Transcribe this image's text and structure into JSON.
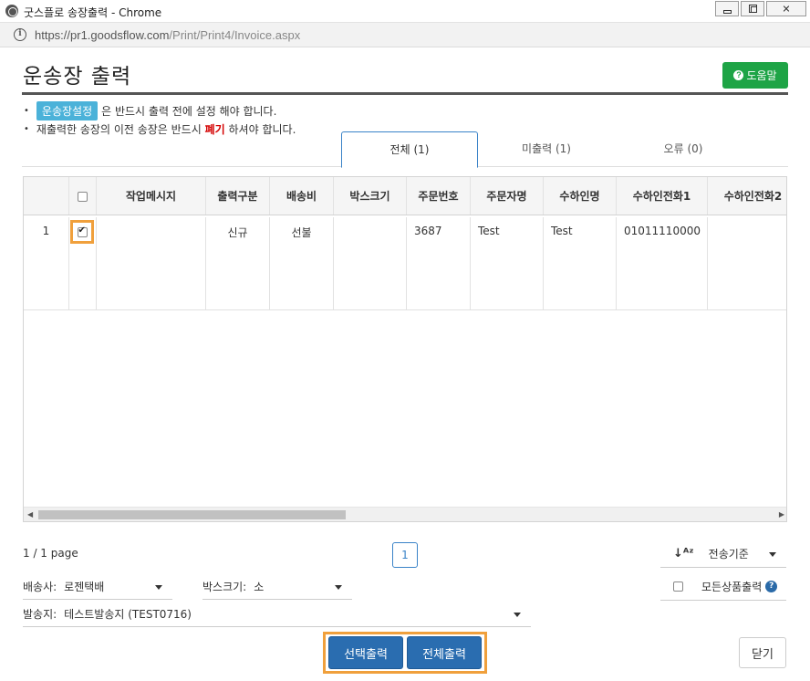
{
  "window": {
    "title": "굿스플로 송장출력 - Chrome",
    "url": "https://pr1.goodsflow.com/Print/Print4/Invoice.aspx",
    "url_host": "https://pr1.goodsflow.com",
    "url_path": "/Print/Print4/Invoice.aspx"
  },
  "page": {
    "title": "운송장 출력",
    "help_label": "도움말",
    "notice1_chip": "운송장설정",
    "notice1_text": "은 반드시 출력 전에 설정 해야 합니다.",
    "notice2_before": "재출력한 송장의 이전 송장은 반드시",
    "notice2_red": "폐기",
    "notice2_after": "하셔야 합니다."
  },
  "tabs": [
    {
      "label": "전체 (1)",
      "active": true
    },
    {
      "label": "미출력 (1)",
      "active": false
    },
    {
      "label": "오류 (0)",
      "active": false
    }
  ],
  "grid": {
    "columns": [
      "",
      "",
      "작업메시지",
      "출력구분",
      "배송비",
      "박스크기",
      "주문번호",
      "주문자명",
      "수하인명",
      "수하인전화1",
      "수하인전화2"
    ],
    "rows": [
      {
        "no": "1",
        "checked": true,
        "message": "",
        "print_type": "신규",
        "shipping_fee": "선불",
        "box_size": "",
        "order_no": "3687",
        "orderer": "Test",
        "receiver": "Test",
        "receiver_phone1": "01011110000",
        "receiver_phone2": ""
      }
    ]
  },
  "footer": {
    "page_info": "1 / 1 page",
    "current_page": "1",
    "sort_label": "전송기준",
    "carrier_label": "배송사:",
    "carrier_value": "로젠택배",
    "box_label": "박스크기:",
    "box_value": "소",
    "sender_label": "발송지:",
    "sender_value": "테스트발송지 (TEST0716)",
    "all_products_label": "모든상품출력",
    "print_selected": "선택출력",
    "print_all": "전체출력",
    "close": "닫기"
  },
  "colors": {
    "help_green": "#1ea446",
    "chip_blue": "#4bb2d9",
    "button_blue": "#2a6db0",
    "highlight_orange": "#f0a03c",
    "warn_red": "#d40000"
  }
}
